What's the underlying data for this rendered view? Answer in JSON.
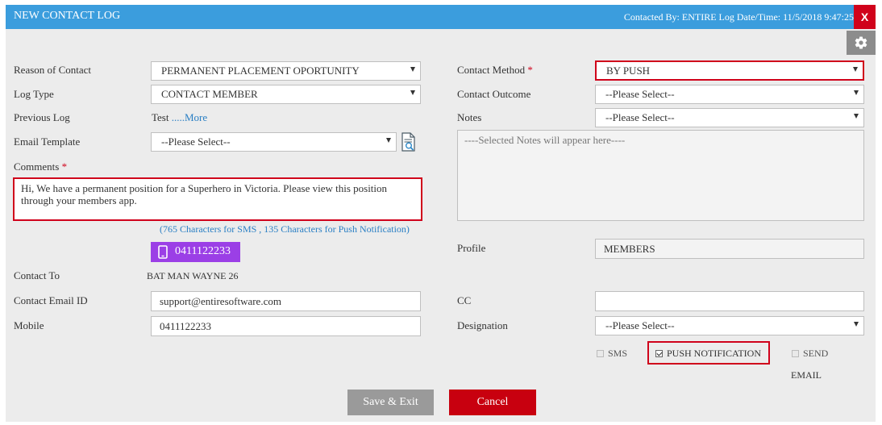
{
  "header": {
    "title": "NEW CONTACT LOG",
    "info": "Contacted By: ENTIRE  Log Date/Time: 11/5/2018 9:47:25",
    "close_label": "X"
  },
  "left": {
    "reason_label": "Reason of Contact",
    "reason_value": "PERMANENT PLACEMENT OPORTUNITY",
    "log_type_label": "Log Type",
    "log_type_value": "CONTACT MEMBER",
    "prev_log_label": "Previous Log",
    "prev_log_value": "Test",
    "prev_log_more": ".....More",
    "email_template_label": "Email Template",
    "email_template_value": "--Please Select--",
    "comments_label": "Comments",
    "comments_value": "Hi, We have a permanent position for a Superhero in Victoria. Please view this position through your members app.",
    "char_note": "(765 Characters for SMS , 135 Characters for Push Notification)",
    "phone_button": "0411122233",
    "contact_to_label": "Contact To",
    "contact_to_value": "BAT MAN WAYNE 26",
    "email_id_label": "Contact Email ID",
    "email_id_value": "support@entiresoftware.com",
    "mobile_label": "Mobile",
    "mobile_value": "0411122233"
  },
  "right": {
    "method_label": "Contact Method",
    "method_value": "BY PUSH",
    "outcome_label": "Contact Outcome",
    "outcome_value": "--Please Select--",
    "notes_label": "Notes",
    "notes_value": "--Please Select--",
    "notes_placeholder": "----Selected Notes will appear here----",
    "profile_label": "Profile",
    "profile_value": "MEMBERS",
    "cc_label": "CC",
    "cc_value": "",
    "designation_label": "Designation",
    "designation_value": "--Please Select--"
  },
  "required_marker": "*",
  "options": {
    "sms_label": "SMS",
    "sms_checked": false,
    "push_label": "PUSH NOTIFICATION",
    "push_checked": true,
    "send_label": "SEND",
    "send_label_2": "EMAIL",
    "send_checked": false
  },
  "footer": {
    "save_label": "Save & Exit",
    "cancel_label": "Cancel"
  },
  "colors": {
    "header": "#3b9ddd",
    "close": "#d0021b",
    "highlight": "#d0021b",
    "phone_button": "#9b3fe6",
    "cancel": "#c8000f",
    "save": "#9a9a9a"
  }
}
